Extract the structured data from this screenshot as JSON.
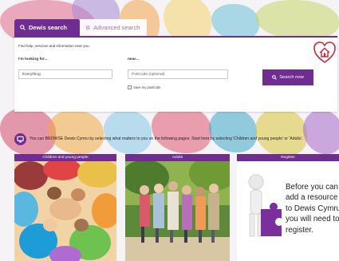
{
  "search": {
    "tab_active": "Dewis search",
    "tab_inactive": "Advanced search",
    "intro": "Find help, services and information near you.",
    "looking_label": "I'm looking for...",
    "looking_value": "Everything",
    "near_label": "near...",
    "postcode_placeholder": "Postcode (optional)",
    "save_postcode": "Save my postcode",
    "button": "Search now"
  },
  "browse": {
    "text": "You can BROWSE Dewis Cymru by selecting what matters to you on the following pages. Start here by selecting 'Children and young people' or 'Adults'."
  },
  "panels": {
    "children": "Children and young people",
    "adults": "Adults",
    "register": "Register",
    "register_text": "Before you can add a resource to Dewis Cymru you will need to register."
  },
  "colors": {
    "brand_purple": "#6f2c91",
    "logo_red": "#c8283c",
    "puzzle_purple": "#7b2f9e"
  },
  "icons": {
    "search": "magnifier-icon",
    "advanced": "gears-icon",
    "browse": "monitor-icon",
    "logo": "heart-house-logo"
  }
}
